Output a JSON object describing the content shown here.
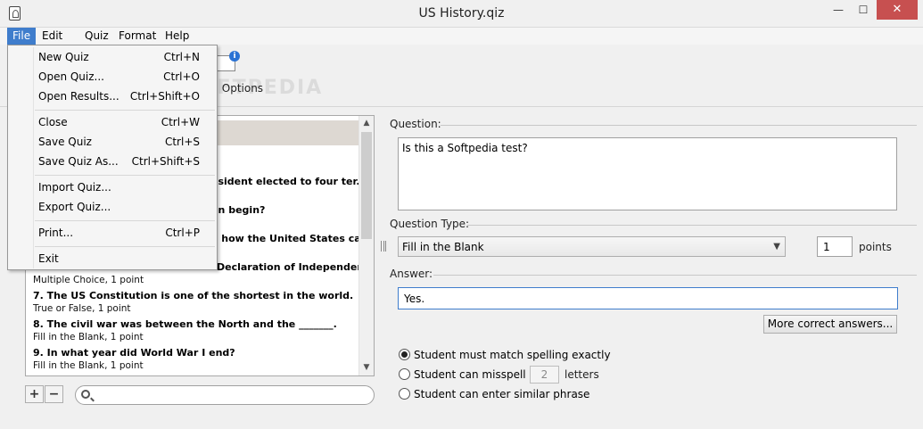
{
  "window": {
    "title": "US History.qiz",
    "minimize": "—",
    "maximize": "☐",
    "close": "✕"
  },
  "menubar": {
    "file": "File",
    "edit": "Edit",
    "quiz": "Quiz",
    "format": "Format",
    "help": "Help"
  },
  "file_menu": {
    "items": [
      {
        "label": "New Quiz",
        "shortcut": "Ctrl+N"
      },
      {
        "label": "Open Quiz...",
        "shortcut": "Ctrl+O"
      },
      {
        "label": "Open Results...",
        "shortcut": "Ctrl+Shift+O"
      },
      {
        "label": "Close",
        "shortcut": "Ctrl+W"
      },
      {
        "label": "Save Quiz",
        "shortcut": "Ctrl+S"
      },
      {
        "label": "Save Quiz As...",
        "shortcut": "Ctrl+Shift+S"
      },
      {
        "label": "Import Quiz...",
        "shortcut": ""
      },
      {
        "label": "Export Quiz...",
        "shortcut": ""
      },
      {
        "label": "Print...",
        "shortcut": "Ctrl+P"
      },
      {
        "label": "Exit",
        "shortcut": ""
      }
    ]
  },
  "toolbar": {
    "options_label": "on Options",
    "watermark": "SOFTPEDIA"
  },
  "question_list": {
    "items": [
      {
        "title": "esident elected to four ter...",
        "sub": ""
      },
      {
        "title": "on begin?",
        "sub": ""
      },
      {
        "title": "e how the United States ca...",
        "sub": ""
      },
      {
        "title": "Declaration of Independen...",
        "sub": "Multiple Choice, 1 point"
      },
      {
        "title": "7. The US Constitution is one of the shortest in the world.",
        "sub": "True or False, 1 point"
      },
      {
        "title": "8. The civil war was between the North and the _______.",
        "sub": "Fill in the Blank, 1 point"
      },
      {
        "title": "9. In what year did World War I end?",
        "sub": "Fill in the Blank, 1 point"
      }
    ],
    "add": "+",
    "remove": "−",
    "search_placeholder": ""
  },
  "editor": {
    "question_label": "Question:",
    "question_text": "Is this a Softpedia test?",
    "type_label": "Question Type:",
    "type_value": "Fill in the Blank",
    "points_value": "1",
    "points_label": "points",
    "answer_label": "Answer:",
    "answer_value": "Yes.",
    "more_answers": "More correct answers...",
    "options": [
      {
        "label": "Student must match spelling exactly",
        "checked": true
      },
      {
        "label": "Student can misspell",
        "checked": false
      },
      {
        "label": "Student can enter similar phrase",
        "checked": false
      }
    ],
    "misspell_count": "2",
    "letters_label": "letters"
  }
}
